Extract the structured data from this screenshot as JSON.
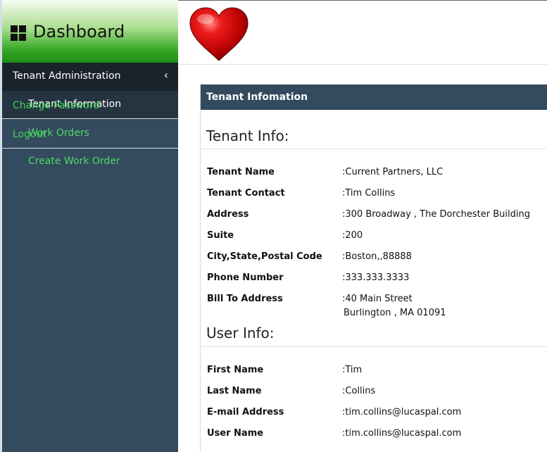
{
  "sidebar": {
    "brand_title": "Dashboard",
    "group_label": "Tenant Administration",
    "items": [
      {
        "label": "Tenant Information"
      },
      {
        "label": "Work Orders"
      },
      {
        "label": "Create Work Order"
      }
    ],
    "overlay_links": [
      {
        "label": "Change Password"
      },
      {
        "label": "Logout"
      }
    ]
  },
  "panel": {
    "header": "Tenant Infomation",
    "tenant_section": "Tenant Info:",
    "user_section": "User Info:",
    "tenant_fields": [
      {
        "label": "Tenant Name",
        "value": ":Current Partners, LLC"
      },
      {
        "label": "Tenant Contact",
        "value": ":Tim Collins"
      },
      {
        "label": "Address",
        "value": ":300 Broadway , The Dorchester Building"
      },
      {
        "label": "Suite",
        "value": ":200"
      },
      {
        "label": "City,State,Postal Code",
        "value": ":Boston,,88888"
      },
      {
        "label": "Phone Number",
        "value": ":333.333.3333"
      },
      {
        "label": "Bill To Address",
        "value": ":40 Main Street",
        "value_line2": "Burlington , MA 01091"
      }
    ],
    "user_fields": [
      {
        "label": "First Name",
        "value": ":Tim"
      },
      {
        "label": "Last Name",
        "value": ":Collins"
      },
      {
        "label": "E-mail Address",
        "value": ":tim.collins@lucaspal.com"
      },
      {
        "label": "User Name",
        "value": ":tim.collins@lucaspal.com"
      }
    ]
  },
  "colors": {
    "sidebar_bg": "#344a5e",
    "nav_head_bg": "#1a222c",
    "link_green": "#4cd964",
    "panel_head_bg": "#344a5e",
    "heart_red": "#d40000"
  }
}
